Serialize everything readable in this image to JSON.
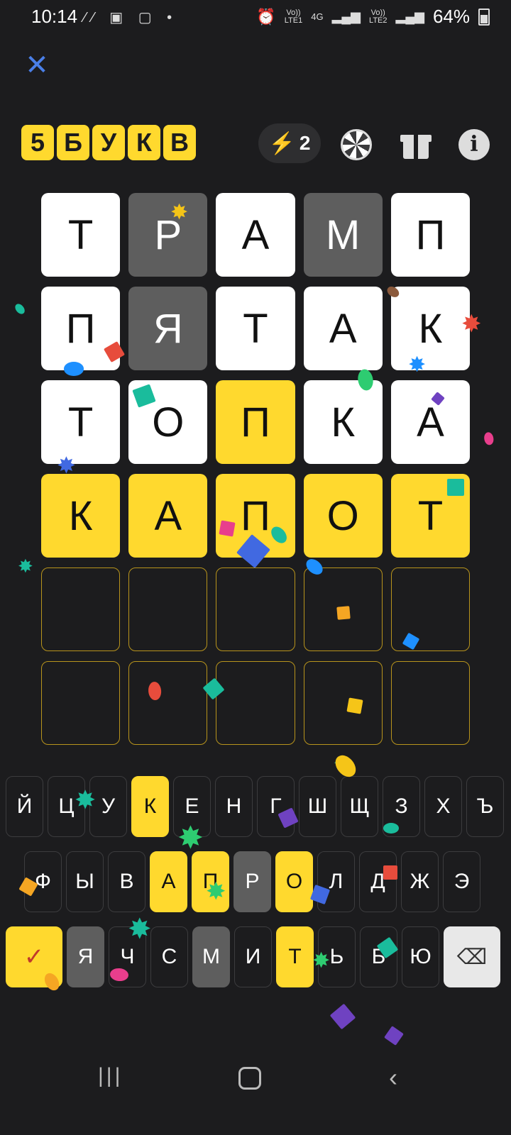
{
  "status_bar": {
    "time": "10:14",
    "network1": "Vo)) LTE1",
    "network2": "4G",
    "network3": "Vo)) LTE2",
    "battery": "64%"
  },
  "header": {
    "logo_letters": [
      "5",
      "Б",
      "У",
      "К",
      "В"
    ],
    "hint_count": "2",
    "icons": [
      "close-icon",
      "lightning-icon",
      "wheel-icon",
      "gift-icon",
      "info-icon"
    ]
  },
  "board": {
    "rows": [
      {
        "letters": [
          "Т",
          "Р",
          "А",
          "М",
          "П"
        ],
        "states": [
          "absent",
          "gray",
          "absent",
          "gray",
          "absent"
        ]
      },
      {
        "letters": [
          "П",
          "Я",
          "Т",
          "А",
          "К"
        ],
        "states": [
          "absent",
          "gray",
          "absent",
          "absent",
          "absent"
        ]
      },
      {
        "letters": [
          "Т",
          "О",
          "П",
          "К",
          "А"
        ],
        "states": [
          "absent",
          "absent",
          "correct",
          "absent",
          "absent"
        ]
      },
      {
        "letters": [
          "К",
          "А",
          "П",
          "О",
          "Т"
        ],
        "states": [
          "correct",
          "correct",
          "correct",
          "correct",
          "correct"
        ]
      },
      {
        "letters": [
          "",
          "",
          "",
          "",
          ""
        ],
        "states": [
          "empty",
          "empty",
          "empty",
          "empty",
          "empty"
        ]
      },
      {
        "letters": [
          "",
          "",
          "",
          "",
          ""
        ],
        "states": [
          "empty",
          "empty",
          "empty",
          "empty",
          "empty"
        ]
      }
    ],
    "colors": {
      "correct": "#ffd92e",
      "gray": "#5e5e5e",
      "absent": "#ffffff"
    }
  },
  "keyboard": {
    "row1": [
      "Й",
      "Ц",
      "У",
      "К",
      "Е",
      "Н",
      "Г",
      "Ш",
      "Щ",
      "З",
      "Х",
      "Ъ"
    ],
    "row2": [
      "Ф",
      "Ы",
      "В",
      "А",
      "П",
      "Р",
      "О",
      "Л",
      "Д",
      "Ж",
      "Э"
    ],
    "row3": [
      "Я",
      "Ч",
      "С",
      "М",
      "И",
      "Т",
      "Ь",
      "Б",
      "Ю"
    ],
    "enter_label": "✓",
    "backspace_label": "⌫"
  }
}
